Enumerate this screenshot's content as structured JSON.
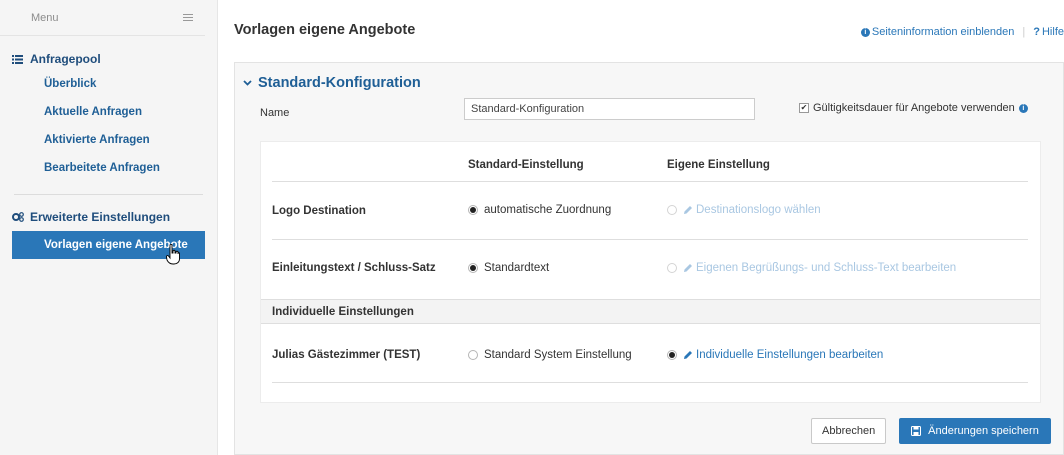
{
  "sidebar": {
    "menu_label": "Menu",
    "menu_icon": "hamburger-icon",
    "sections": [
      {
        "icon": "list-icon",
        "title": "Anfragepool",
        "items": [
          {
            "label": "Überblick"
          },
          {
            "label": "Aktuelle Anfragen"
          },
          {
            "label": "Aktivierte Anfragen"
          },
          {
            "label": "Bearbeitete Anfragen"
          }
        ]
      },
      {
        "icon": "gears-icon",
        "title": "Erweiterte Einstellungen",
        "items": [
          {
            "label": "Vorlagen eigene Angebote",
            "active": true
          }
        ]
      }
    ]
  },
  "header": {
    "title": "Vorlagen eigene Angebote",
    "info_link": "Seiteninformation einblenden",
    "help_link": "Hilfe",
    "help_icon": "?"
  },
  "panel": {
    "title": "Standard-Konfiguration",
    "name_label": "Name",
    "name_value": "Standard-Konfiguration",
    "validity_label": "Gültigkeitsdauer für Angebote verwenden",
    "validity_checked": true
  },
  "table": {
    "columns": [
      "",
      "Standard-Einstellung",
      "Eigene Einstellung"
    ],
    "rows": [
      {
        "label": "Logo Destination",
        "standard": "automatische Zuordnung",
        "standard_selected": true,
        "custom": "Destinationslogo wählen",
        "custom_selected": false
      },
      {
        "label": "Einleitungstext / Schluss-Satz",
        "standard": "Standardtext",
        "standard_selected": true,
        "custom": "Eigenen Begrüßungs- und Schluss-Text bearbeiten",
        "custom_selected": false
      }
    ],
    "group_title": "Individuelle Einstellungen",
    "group_rows": [
      {
        "label": "Julias Gästezimmer (TEST)",
        "standard": "Standard System Einstellung",
        "standard_selected": false,
        "custom": "Individuelle Einstellungen bearbeiten",
        "custom_selected": true
      }
    ]
  },
  "actions": {
    "cancel_label": "Abbrechen",
    "save_label": "Änderungen speichern",
    "save_icon": "floppy-disk-icon"
  },
  "colors": {
    "accent": "#2a77b8",
    "nav_text": "#1f5f96",
    "link_disabled": "#a9c7e2"
  }
}
